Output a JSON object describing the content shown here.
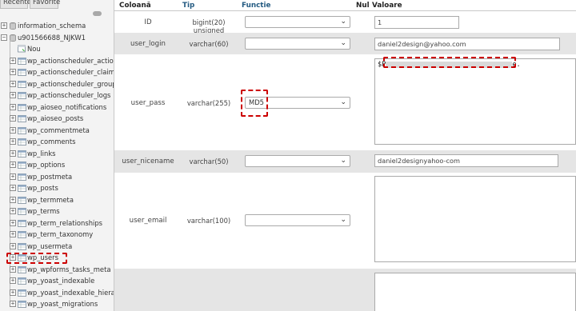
{
  "sidebar": {
    "tabs": [
      "Recente",
      "Favorite"
    ],
    "databases": [
      {
        "name": "information_schema",
        "expanded": false
      },
      {
        "name": "u901566688_NJKW1",
        "expanded": true
      }
    ],
    "new_label": "Nou",
    "tables": [
      "wp_actionscheduler_actions",
      "wp_actionscheduler_claims",
      "wp_actionscheduler_groups",
      "wp_actionscheduler_logs",
      "wp_aioseo_notifications",
      "wp_aioseo_posts",
      "wp_commentmeta",
      "wp_comments",
      "wp_links",
      "wp_options",
      "wp_postmeta",
      "wp_posts",
      "wp_termmeta",
      "wp_terms",
      "wp_term_relationships",
      "wp_term_taxonomy",
      "wp_usermeta",
      "wp_users",
      "wp_wpforms_tasks_meta",
      "wp_yoast_indexable",
      "wp_yoast_indexable_hierarch",
      "wp_yoast_migrations"
    ],
    "highlighted_table": "wp_users"
  },
  "table": {
    "headers": {
      "column": "Coloană",
      "type": "Tip",
      "function": "Functie",
      "null": "Nul",
      "value": "Valoare"
    },
    "rows": [
      {
        "column": "ID",
        "type": "bigint(20) unsigned",
        "function": "",
        "value": "1"
      },
      {
        "column": "user_login",
        "type": "varchar(60)",
        "function": "",
        "value": "daniel2design@yahoo.com"
      },
      {
        "column": "user_pass",
        "type": "varchar(255)",
        "function": "MD5",
        "value": "$P",
        "value_suffix": "e."
      },
      {
        "column": "user_nicename",
        "type": "varchar(50)",
        "function": "",
        "value": "daniel2designyahoo-com"
      },
      {
        "column": "user_email",
        "type": "varchar(100)",
        "function": "",
        "value": ""
      }
    ]
  },
  "colors": {
    "highlight": "#cc0000",
    "header_link": "#235a81",
    "row_gray": "#e5e5e5"
  },
  "icons": [
    "expand-plus-icon",
    "collapse-minus-icon",
    "database-icon",
    "table-icon",
    "new-table-icon",
    "dropdown-chevron-icon"
  ]
}
